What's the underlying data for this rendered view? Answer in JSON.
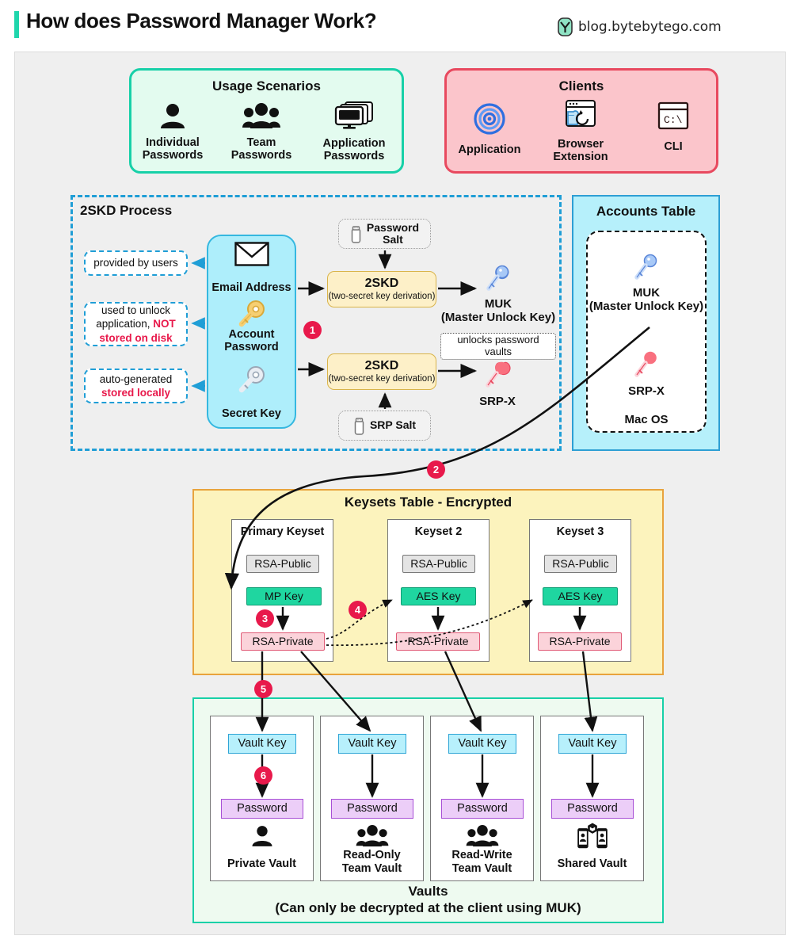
{
  "header": {
    "title": "How does Password Manager Work?",
    "brand": "blog.bytebytego.com",
    "accent": "#1fd6ac"
  },
  "usage_scenarios": {
    "title": "Usage Scenarios",
    "color": "#e3fbef",
    "border": "#17d0a8",
    "items": [
      {
        "icon": "person-icon",
        "label": "Individual\nPasswords",
        "line1": "Individual",
        "line2": "Passwords"
      },
      {
        "icon": "people-group-icon",
        "label": "Team\nPasswords",
        "line1": "Team",
        "line2": "Passwords"
      },
      {
        "icon": "monitors-icon",
        "label": "Application\nPasswords",
        "line1": "Application",
        "line2": "Passwords"
      }
    ]
  },
  "clients": {
    "title": "Clients",
    "color": "#fbc5cb",
    "border": "#e8495f",
    "items": [
      {
        "icon": "spiral-app-icon",
        "line1": "Application",
        "line2": ""
      },
      {
        "icon": "browser-extension-icon",
        "line1": "Browser",
        "line2": "Extension"
      },
      {
        "icon": "cli-terminal-icon",
        "line1": "CLI",
        "line2": "",
        "glyph": "C:\\"
      }
    ]
  },
  "skd": {
    "title": "2SKD Process",
    "border": "#1f9ed6",
    "notes": [
      {
        "text": "provided by users"
      },
      {
        "pre": "used to unlock\napplication, ",
        "red": "NOT\nstored on disk",
        "l1": "used to unlock",
        "l2a": "application, ",
        "l2b": "NOT",
        "l3": "stored on disk"
      },
      {
        "l1": "auto-generated",
        "l2": "stored locally"
      }
    ],
    "inputs": [
      {
        "icon": "envelope-icon",
        "label": "Email Address"
      },
      {
        "icon": "gold-key-icon",
        "line1": "Account",
        "line2": "Password"
      },
      {
        "icon": "silver-key-icon",
        "label": "Secret Key"
      }
    ],
    "salts": [
      {
        "icon": "salt-shaker-icon",
        "line1": "Password",
        "line2": "Salt"
      },
      {
        "icon": "salt-shaker-icon",
        "line1": "SRP Salt",
        "line2": ""
      }
    ],
    "boxes": [
      {
        "title": "2SKD",
        "sub": "(two-secret key derivation)"
      },
      {
        "title": "2SKD",
        "sub": "(two-secret key derivation)"
      }
    ],
    "outputs": [
      {
        "icon": "blue-key-icon",
        "line1": "MUK",
        "line2": "(Master Unlock Key)",
        "note1": "unlocks password",
        "note2": "vaults"
      },
      {
        "icon": "red-key-icon",
        "line1": "SRP-X",
        "line2": ""
      }
    ]
  },
  "accounts_table": {
    "title": "Accounts Table",
    "bg": "#b6f0fb",
    "border": "#2e9fd4",
    "entries": [
      {
        "icon": "blue-key-icon",
        "line1": "MUK",
        "line2": "(Master Unlock Key)"
      },
      {
        "icon": "red-key-icon",
        "line1": "SRP-X",
        "line2": ""
      }
    ],
    "os_label": "Mac OS"
  },
  "keysets_table": {
    "title": "Keysets Table - Encrypted",
    "bg": "#fcf3bd",
    "border": "#e8a33d",
    "keysets": [
      {
        "name": "Primary Keyset",
        "rows": [
          "RSA-Public",
          "MP Key",
          "RSA-Private"
        ],
        "mid_type": "mp"
      },
      {
        "name": "Keyset 2",
        "rows": [
          "RSA-Public",
          "AES Key",
          "RSA-Private"
        ],
        "mid_type": "aes"
      },
      {
        "name": "Keyset 3",
        "rows": [
          "RSA-Public",
          "AES Key",
          "RSA-Private"
        ],
        "mid_type": "aes"
      }
    ]
  },
  "vaults": {
    "bg": "#eefaf0",
    "border": "#17d0a8",
    "caption_line1": "Vaults",
    "caption_line2": "(Can only be decrypted at the client using MUK)",
    "items": [
      {
        "key": "Vault Key",
        "password": "Password",
        "icon": "person-icon",
        "l1": "Private Vault",
        "l2": ""
      },
      {
        "key": "Vault Key",
        "password": "Password",
        "icon": "people-group-icon",
        "l1": "Read-Only",
        "l2": "Team Vault"
      },
      {
        "key": "Vault Key",
        "password": "Password",
        "icon": "people-group-icon",
        "l1": "Read-Write",
        "l2": "Team Vault"
      },
      {
        "key": "Vault Key",
        "password": "Password",
        "icon": "shared-devices-icon",
        "l1": "Shared Vault",
        "l2": ""
      }
    ]
  },
  "steps": {
    "color": "#e8194b",
    "labels": [
      "1",
      "2",
      "3",
      "4",
      "5",
      "6"
    ]
  }
}
